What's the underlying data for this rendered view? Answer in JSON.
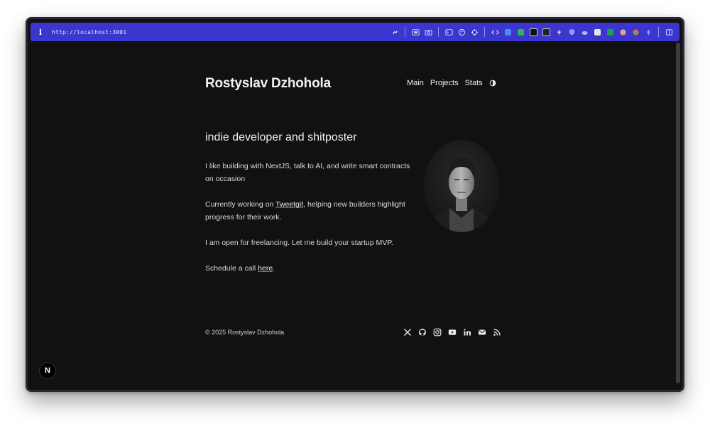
{
  "browser": {
    "url": "http://localhost:3001",
    "extension_icons": [
      "link-icon",
      "screenshot-icon",
      "camera-icon",
      "terminal-icon",
      "palette-icon",
      "crosshair-icon",
      "code-icon",
      "translate-icon",
      "green-square-icon",
      "dark-square-icon",
      "dark-square-icon-2",
      "bolt-icon",
      "shield-icon",
      "cloud-icon",
      "image-icon",
      "green-d-icon",
      "avatar-icon",
      "colorful-icon",
      "waveform-icon",
      "sidebar-icon"
    ]
  },
  "site": {
    "title": "Rostyslav Dzhohola",
    "nav": [
      "Main",
      "Projects",
      "Stats"
    ]
  },
  "main": {
    "tagline": "indie developer and shitposter",
    "p1": "I like building with NextJS, talk to AI, and write smart contracts on occasion",
    "p2_before": "Currently working on ",
    "p2_link": "Tweetgit",
    "p2_after": ", helping new builders highlight progress for their work.",
    "p3": "I am open for freelancing. Let me build your startup MVP.",
    "p4_before": "Schedule a call ",
    "p4_link": "here",
    "p4_after": "."
  },
  "footer": {
    "copyright": "© 2025 Rostyslav Dzhohola",
    "social_icons": [
      "x-icon",
      "github-icon",
      "instagram-icon",
      "youtube-icon",
      "linkedin-icon",
      "mail-icon",
      "rss-icon"
    ]
  },
  "dev": {
    "badge": "N"
  }
}
